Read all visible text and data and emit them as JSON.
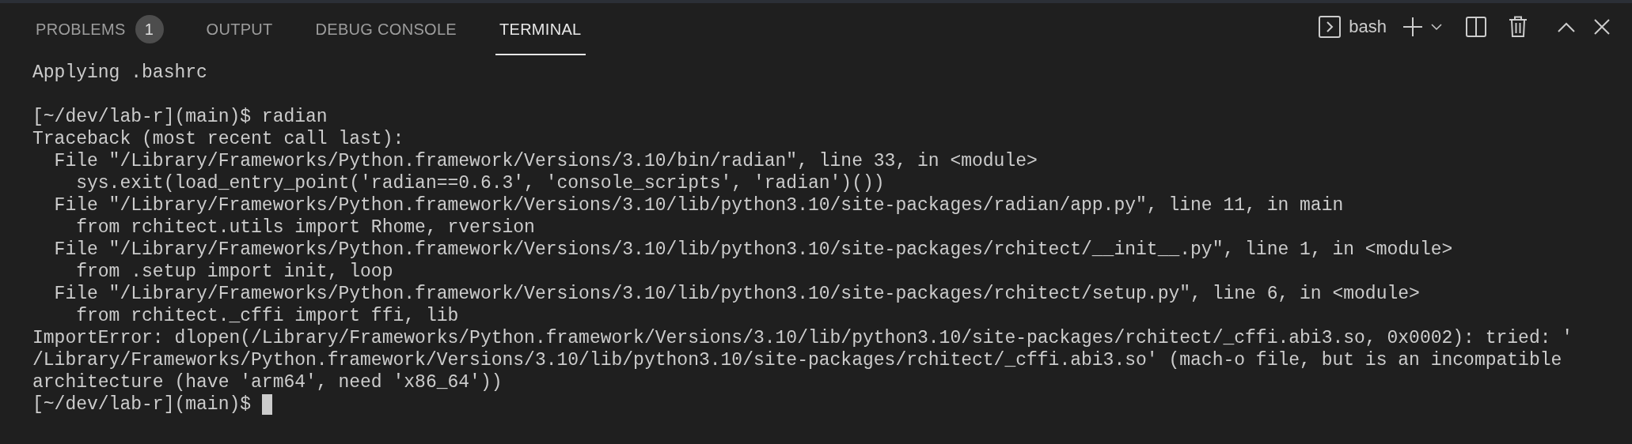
{
  "tabs": [
    {
      "label": "PROBLEMS",
      "selected": false,
      "badge": "1"
    },
    {
      "label": "OUTPUT",
      "selected": false
    },
    {
      "label": "DEBUG CONSOLE",
      "selected": false
    },
    {
      "label": "TERMINAL",
      "selected": true
    }
  ],
  "toolbar": {
    "shell": "bash"
  },
  "terminal": {
    "blocks": [
      [
        "Applying .bashrc"
      ],
      [
        "[~/dev/lab-r](main)$ radian",
        "Traceback (most recent call last):",
        "  File \"/Library/Frameworks/Python.framework/Versions/3.10/bin/radian\", line 33, in <module>",
        "    sys.exit(load_entry_point('radian==0.6.3', 'console_scripts', 'radian')())",
        "  File \"/Library/Frameworks/Python.framework/Versions/3.10/lib/python3.10/site-packages/radian/app.py\", line 11, in main",
        "    from rchitect.utils import Rhome, rversion",
        "  File \"/Library/Frameworks/Python.framework/Versions/3.10/lib/python3.10/site-packages/rchitect/__init__.py\", line 1, in <module>",
        "    from .setup import init, loop",
        "  File \"/Library/Frameworks/Python.framework/Versions/3.10/lib/python3.10/site-packages/rchitect/setup.py\", line 6, in <module>",
        "    from rchitect._cffi import ffi, lib",
        "ImportError: dlopen(/Library/Frameworks/Python.framework/Versions/3.10/lib/python3.10/site-packages/rchitect/_cffi.abi3.so, 0x0002): tried: '",
        "/Library/Frameworks/Python.framework/Versions/3.10/lib/python3.10/site-packages/rchitect/_cffi.abi3.so' (mach-o file, but is an incompatible",
        "architecture (have 'arm64', need 'x86_64'))"
      ]
    ],
    "prompt": {
      "text": "[~/dev/lab-r](main)$",
      "cursor": true
    }
  }
}
